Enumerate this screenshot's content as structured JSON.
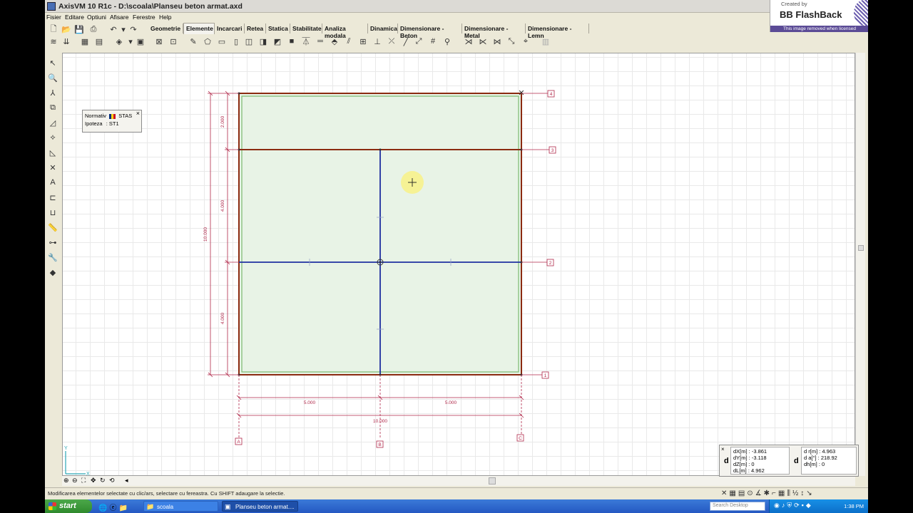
{
  "window": {
    "title": "AxisVM 10 R1c - D:\\scoala\\Planseu beton armat.axd"
  },
  "menu": [
    "Fisier",
    "Editare",
    "Optiuni",
    "Afisare",
    "Ferestre",
    "Help"
  ],
  "tabs": [
    {
      "label": "Geometrie",
      "active": false
    },
    {
      "label": "Elemente",
      "active": true
    },
    {
      "label": "Incarcari",
      "active": false
    },
    {
      "label": "Retea",
      "active": false
    },
    {
      "label": "Statica",
      "active": false
    },
    {
      "label": "Stabilitate",
      "active": false
    },
    {
      "label": "Analiza modala",
      "active": false
    },
    {
      "label": "Dinamica",
      "active": false
    },
    {
      "label": "Dimensionare - Beton",
      "active": false
    },
    {
      "label": "Dimensionare - Metal",
      "active": false
    },
    {
      "label": "Dimensionare - Lemn",
      "active": false
    }
  ],
  "brand": {
    "created_by": "Created by",
    "name": "BB FlashBack",
    "license_note": "This image removed when licensed"
  },
  "info_panel": {
    "normativ_label": "Normativ",
    "normativ_value": "STAS",
    "ipoteza_label": "Ipoteza",
    "ipoteza_value": ": ST1"
  },
  "drawing": {
    "dim_left_top": "2.000",
    "dim_left_mid": "4.000",
    "dim_left_bot": "4.000",
    "dim_left_total": "10.000",
    "dim_bottom_left": "5.000",
    "dim_bottom_right": "5.000",
    "dim_bottom_total": "10.000",
    "row_labels": [
      "4",
      "3",
      "2",
      "1"
    ],
    "col_labels": [
      "A",
      "B",
      "C"
    ],
    "axis_y": "Y",
    "axis_x": "X"
  },
  "coords": {
    "dx": "dX[m] : -3.861",
    "dy": "dY[m] : -3.118",
    "dz": "dZ[m] : 0",
    "dl": "dL[m] : 4.962",
    "dr": "d r[m] : 4.963",
    "da": "d a[°] : 218.92",
    "dh": "dh[m] : 0",
    "d_symbol": "d"
  },
  "status": {
    "message": "Modificarea elementelor selectate cu clic/ars, selectare cu fereastra. Cu SHIFT adaugare la selectie."
  },
  "taskbar": {
    "start": "start",
    "tasks": [
      "scoala",
      "Planseu beton armat...."
    ],
    "search_placeholder": "Search Desktop",
    "clock": "1:38 PM"
  },
  "colors": {
    "slab_fill": "#e8f3e6",
    "slab_edge": "#7ab870",
    "beam": "#8b2a10",
    "rib": "#1f2fa0",
    "dimension": "#b0284a",
    "accent_purple": "#5b4b96"
  }
}
